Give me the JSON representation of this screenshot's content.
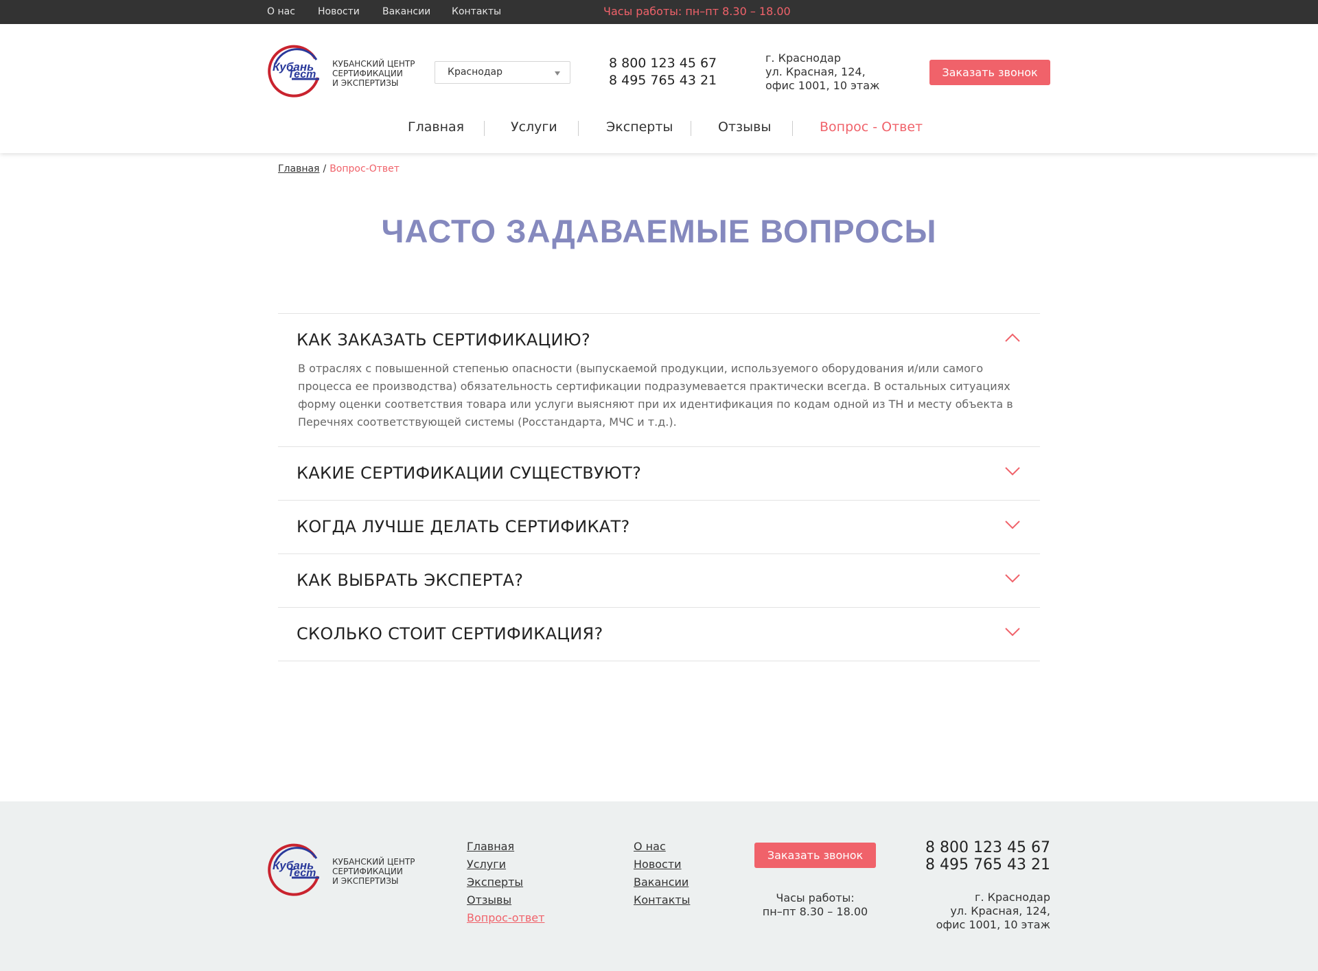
{
  "topbar": {
    "links": [
      "О нас",
      "Новости",
      "Вакансии",
      "Контакты"
    ],
    "hours": "Часы работы: пн–пт 8.30 – 18.00"
  },
  "logo": {
    "brand_line1": "Кубань",
    "brand_line2": "Тест",
    "caption": [
      "Кубанский центр",
      "сертификации",
      "и экспертизы"
    ],
    "colors": {
      "ring": "#c9232e",
      "text": "#2a3a9b"
    }
  },
  "header": {
    "city": "Краснодар",
    "phones": [
      "8 800 123 45 67",
      "8 495 765 43 21"
    ],
    "address": [
      "г. Краснодар",
      "ул. Красная, 124,",
      "офис 1001, 10 этаж"
    ],
    "call_button": "Заказать звонок"
  },
  "nav": {
    "items": [
      "Главная",
      "Услуги",
      "Эксперты",
      "Отзывы",
      "Вопрос - Ответ"
    ],
    "active_index": 4
  },
  "breadcrumbs": {
    "home": "Главная",
    "separator": "/",
    "current": "Вопрос-Ответ"
  },
  "page_title": "Часто задаваемые вопросы",
  "faq": [
    {
      "question": "Как заказать сертификацию?",
      "expanded": true,
      "answer": "В отраслях с повышенной степенью опасности (выпускаемой продукции, используемого оборудования и/или самого процесса ее производства) обязательность сертификации подразумевается практически всегда. В остальных ситуациях форму оценки соответствия товара или услуги выясняют при их идентификация по кодам одной из ТН и месту объекта в Перечнях соответствующей системы (Росстандарта, МЧС и т.д.)."
    },
    {
      "question": "Какие сертификации существуют?",
      "expanded": false
    },
    {
      "question": "Когда лучше делать сертификат?",
      "expanded": false
    },
    {
      "question": "Как выбрать эксперта?",
      "expanded": false
    },
    {
      "question": "Сколько стоит сертификация?",
      "expanded": false
    }
  ],
  "footer": {
    "nav1": [
      "Главная",
      "Услуги",
      "Эксперты",
      "Отзывы",
      "Вопрос-ответ"
    ],
    "nav1_active_index": 4,
    "nav2": [
      "О нас",
      "Новости",
      "Вакансии",
      "Контакты"
    ],
    "call_button": "Заказать звонок",
    "hours": [
      "Часы работы:",
      "пн–пт 8.30 – 18.00"
    ],
    "phones": [
      "8 800 123 45 67",
      "8 495 765 43 21"
    ],
    "address": [
      "г. Краснодар",
      "ул. Красная, 124,",
      "офис 1001, 10 этаж"
    ]
  },
  "colors": {
    "accent": "#f0626a",
    "title": "#8589be",
    "topbar": "#333333",
    "footer_bg": "#edf0f0"
  }
}
